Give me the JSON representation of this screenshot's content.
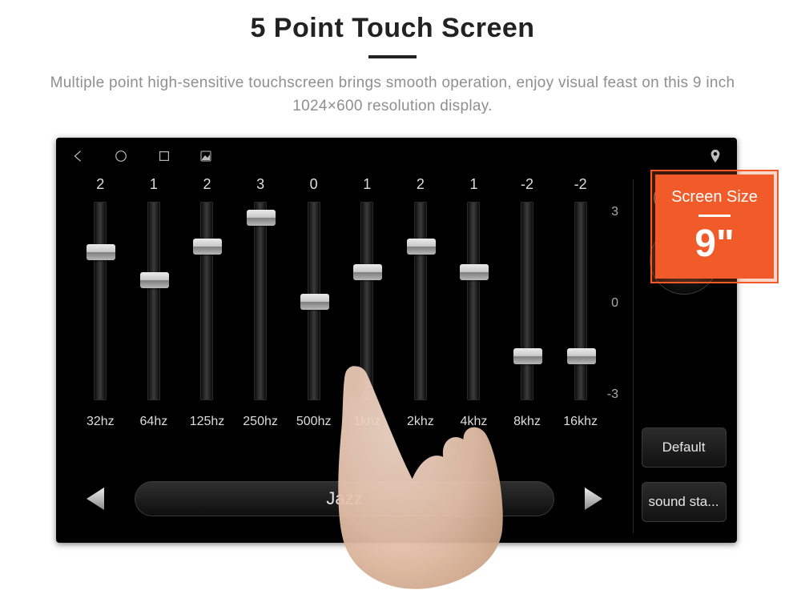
{
  "header": {
    "title": "5 Point Touch Screen",
    "subtitle": "Multiple point high-sensitive touchscreen brings smooth operation, enjoy visual feast on this 9 inch 1024×600 resolution display."
  },
  "badge": {
    "label": "Screen Size",
    "value": "9\""
  },
  "eq": {
    "bands": [
      {
        "freq": "32hz",
        "value": "2",
        "pos": 23
      },
      {
        "freq": "64hz",
        "value": "1",
        "pos": 38
      },
      {
        "freq": "125hz",
        "value": "2",
        "pos": 20
      },
      {
        "freq": "250hz",
        "value": "3",
        "pos": 4
      },
      {
        "freq": "500hz",
        "value": "0",
        "pos": 50
      },
      {
        "freq": "1khz",
        "value": "1",
        "pos": 34
      },
      {
        "freq": "2khz",
        "value": "2",
        "pos": 20
      },
      {
        "freq": "4khz",
        "value": "1",
        "pos": 34
      },
      {
        "freq": "8khz",
        "value": "-2",
        "pos": 80
      },
      {
        "freq": "16khz",
        "value": "-2",
        "pos": 80
      }
    ],
    "axis": {
      "max": "3",
      "mid": "0",
      "min": "-3"
    },
    "preset": "Jazz"
  },
  "sidebar": {
    "default_label": "Default",
    "soundsta_label": "sound sta..."
  }
}
